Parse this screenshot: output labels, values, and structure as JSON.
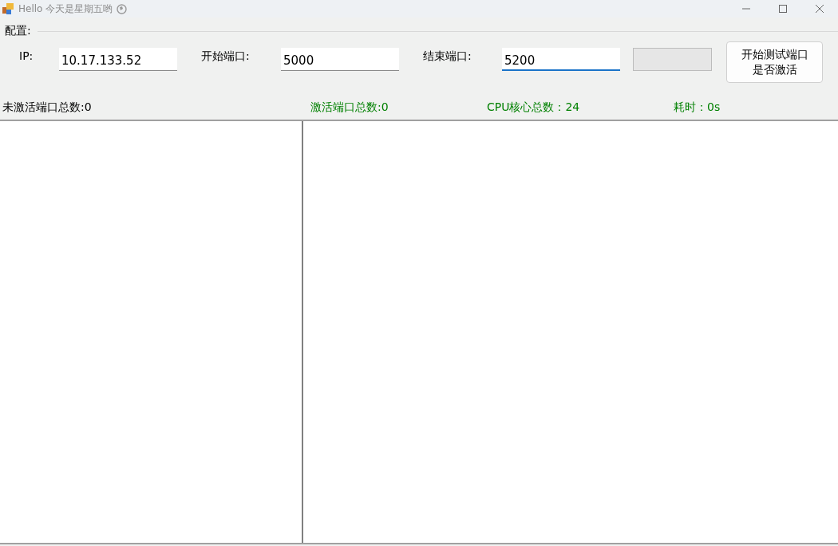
{
  "window": {
    "title": "Hello 今天是星期五哟"
  },
  "config": {
    "legend": "配置:",
    "fields": [
      {
        "label": "IP:",
        "value": "10.17.133.52",
        "focused": false
      },
      {
        "label": "开始端口:",
        "value": "5000",
        "focused": false
      },
      {
        "label": "结束端口:",
        "value": "5200",
        "focused": true
      }
    ],
    "progress": {
      "level": 0
    },
    "button": "开始测试端口是否激活"
  },
  "stats": [
    {
      "text": "未激活端口总数:0",
      "color": "#000000"
    },
    {
      "text": "激活端口总数:0",
      "color": "#008000"
    },
    {
      "text": "CPU核心总数：24",
      "color": "#008000"
    },
    {
      "text": "耗时：0s",
      "color": "#008000"
    }
  ]
}
